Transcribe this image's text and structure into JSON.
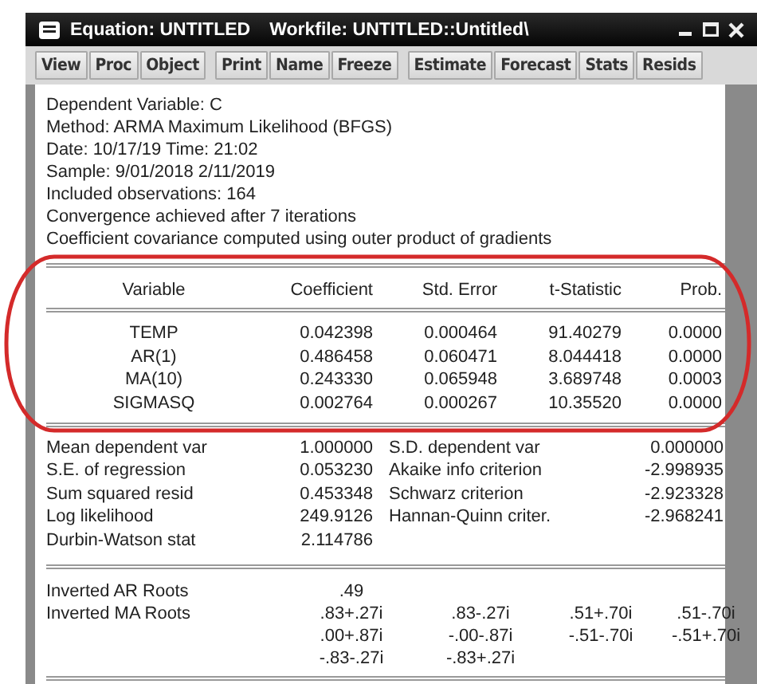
{
  "window": {
    "title_parts": [
      "Equation: UNTITLED",
      "Workfile: UNTITLED::Untitled\\"
    ]
  },
  "toolbar": [
    [
      "View",
      "Proc",
      "Object"
    ],
    [
      "Print",
      "Name",
      "Freeze"
    ],
    [
      "Estimate",
      "Forecast",
      "Stats",
      "Resids"
    ]
  ],
  "header_lines": [
    "Dependent Variable: C",
    "Method: ARMA Maximum Likelihood (BFGS)",
    "Date: 10/17/19   Time: 21:02",
    "Sample: 9/01/2018 2/11/2019",
    "Included observations: 164",
    "Convergence achieved after 7 iterations",
    "Coefficient covariance computed using outer product of gradients"
  ],
  "table": {
    "columns": [
      "Variable",
      "Coefficient",
      "Std. Error",
      "t-Statistic",
      "Prob."
    ],
    "rows": [
      [
        "TEMP",
        "0.042398",
        "0.000464",
        "91.40279",
        "0.0000"
      ],
      [
        "AR(1)",
        "0.486458",
        "0.060471",
        "8.044418",
        "0.0000"
      ],
      [
        "MA(10)",
        "0.243330",
        "0.065948",
        "3.689748",
        "0.0003"
      ],
      [
        "SIGMASQ",
        "0.002764",
        "0.000267",
        "10.35520",
        "0.0000"
      ]
    ]
  },
  "statistics": [
    [
      "Mean dependent var",
      "1.000000",
      "S.D. dependent var",
      "0.000000"
    ],
    [
      "S.E. of regression",
      "0.053230",
      "Akaike info criterion",
      "-2.998935"
    ],
    [
      "Sum squared resid",
      "0.453348",
      "Schwarz criterion",
      "-2.923328"
    ],
    [
      "Log likelihood",
      "249.9126",
      "Hannan-Quinn criter.",
      "-2.968241"
    ],
    [
      "Durbin-Watson stat",
      "2.114786"
    ]
  ],
  "roots": [
    {
      "label": "Inverted AR Roots",
      "values": [
        ".49"
      ]
    },
    {
      "label": "Inverted MA Roots",
      "values": [
        ".83+.27i",
        ".83-.27i",
        ".51+.70i",
        ".51-.70i"
      ]
    },
    {
      "values": [
        ".00+.87i",
        "-.00-.87i",
        "-.51-.70i",
        "-.51+.70i"
      ]
    },
    {
      "values": [
        "-.83-.27i",
        "-.83+.27i"
      ]
    }
  ]
}
